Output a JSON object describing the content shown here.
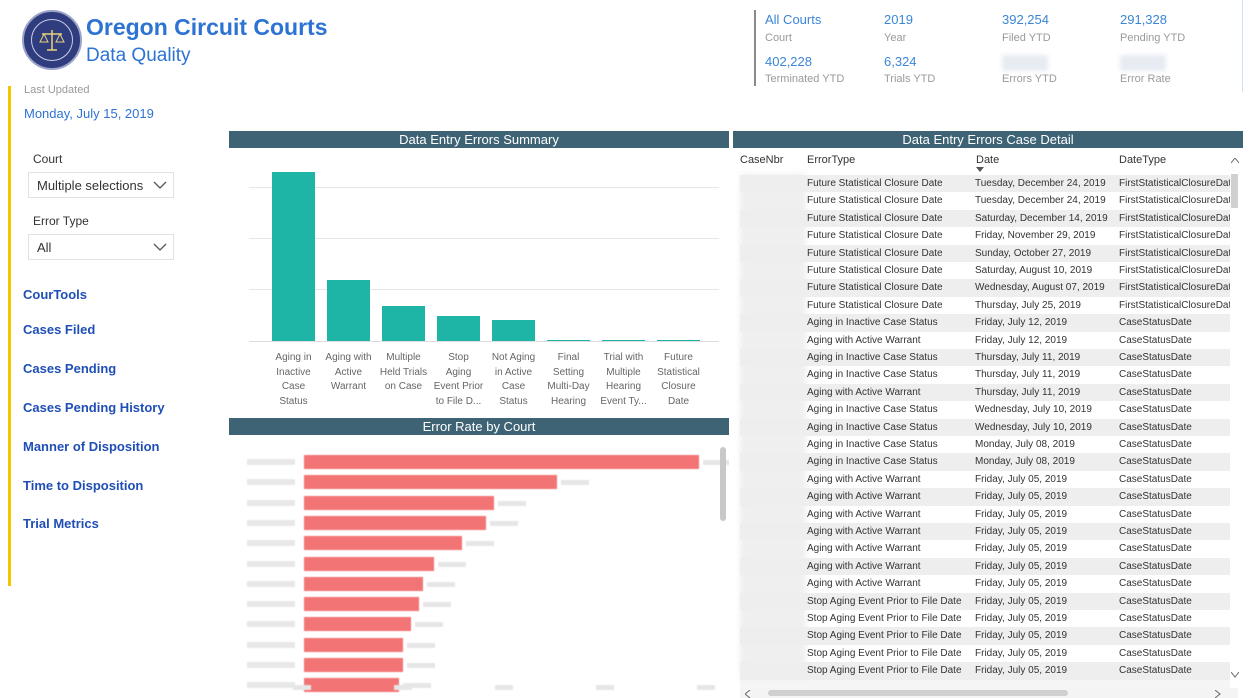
{
  "header": {
    "title": "Oregon Circuit Courts",
    "subtitle": "Data Quality",
    "last_updated_label": "Last Updated",
    "last_updated_date": "Monday, July 15, 2019",
    "seal_icon": "oregon-judicial-department-seal"
  },
  "kpis": [
    {
      "value": "All Courts",
      "label": "Court"
    },
    {
      "value": "2019",
      "label": "Year"
    },
    {
      "value": "392,254",
      "label": "Filed YTD"
    },
    {
      "value": "291,328",
      "label": "Pending YTD"
    },
    {
      "value": "402,228",
      "label": "Terminated YTD"
    },
    {
      "value": "6,324",
      "label": "Trials YTD"
    },
    {
      "value": "",
      "label": "Errors YTD"
    },
    {
      "value": "",
      "label": "Error Rate"
    }
  ],
  "filters": {
    "court": {
      "label": "Court",
      "value": "Multiple selections"
    },
    "error_type": {
      "label": "Error Type",
      "value": "All"
    }
  },
  "nav": [
    "CourTools",
    "Cases Filed",
    "Cases Pending",
    "Cases Pending History",
    "Manner of Disposition",
    "Time to Disposition",
    "Trial Metrics"
  ],
  "summary_chart": {
    "title": "Data Entry Errors Summary",
    "chart_data": {
      "type": "bar",
      "categories": [
        "Aging in Inactive Case Status",
        "Aging with Active Warrant",
        "Multiple Held Trials on Case",
        "Stop Aging Event Prior to File D...",
        "Not Aging in Active Case Status",
        "Final Setting Multi-Day Hearing",
        "Trial with Multiple Hearing Event Ty...",
        "Future Statistical Closure Date"
      ],
      "category_lines": [
        [
          "Aging in",
          "Inactive",
          "Case",
          "Status"
        ],
        [
          "Aging with",
          "Active",
          "Warrant"
        ],
        [
          "Multiple",
          "Held Trials",
          "on Case"
        ],
        [
          "Stop",
          "Aging",
          "Event Prior",
          "to File D..."
        ],
        [
          "Not Aging",
          "in Active",
          "Case",
          "Status"
        ],
        [
          "Final",
          "Setting",
          "Multi-Day",
          "Hearing"
        ],
        [
          "Trial with",
          "Multiple",
          "Hearing",
          "Event Ty..."
        ],
        [
          "Future",
          "Statistical",
          "Closure",
          "Date"
        ]
      ],
      "values": [
        100,
        36,
        21,
        15,
        12.5,
        0.6,
        0.6,
        0.6
      ],
      "ylim": [
        0,
        100
      ],
      "grid": true,
      "color": "#1fb5a6"
    }
  },
  "rate_chart": {
    "title": "Error Rate by Court",
    "chart_data": {
      "type": "bar",
      "orientation": "horizontal",
      "note_blurred": true,
      "values": [
        1.0,
        0.64,
        0.48,
        0.46,
        0.4,
        0.33,
        0.3,
        0.29,
        0.27,
        0.25,
        0.25,
        0.24
      ],
      "color": "#f27474"
    }
  },
  "detail_table": {
    "title": "Data Entry Errors Case Detail",
    "columns": [
      "CaseNbr",
      "ErrorType",
      "Date",
      "DateType"
    ],
    "rows": [
      [
        "Future Statistical Closure Date",
        "Tuesday, December 24, 2019",
        "FirstStatisticalClosureDat"
      ],
      [
        "Future Statistical Closure Date",
        "Tuesday, December 24, 2019",
        "FirstStatisticalClosureDat"
      ],
      [
        "Future Statistical Closure Date",
        "Saturday, December 14, 2019",
        "FirstStatisticalClosureDat"
      ],
      [
        "Future Statistical Closure Date",
        "Friday, November 29, 2019",
        "FirstStatisticalClosureDat"
      ],
      [
        "Future Statistical Closure Date",
        "Sunday, October 27, 2019",
        "FirstStatisticalClosureDat"
      ],
      [
        "Future Statistical Closure Date",
        "Saturday, August 10, 2019",
        "FirstStatisticalClosureDat"
      ],
      [
        "Future Statistical Closure Date",
        "Wednesday, August 07, 2019",
        "FirstStatisticalClosureDat"
      ],
      [
        "Future Statistical Closure Date",
        "Thursday, July 25, 2019",
        "FirstStatisticalClosureDat"
      ],
      [
        "Aging in Inactive Case Status",
        "Friday, July 12, 2019",
        "CaseStatusDate"
      ],
      [
        "Aging with Active Warrant",
        "Friday, July 12, 2019",
        "CaseStatusDate"
      ],
      [
        "Aging in Inactive Case Status",
        "Thursday, July 11, 2019",
        "CaseStatusDate"
      ],
      [
        "Aging in Inactive Case Status",
        "Thursday, July 11, 2019",
        "CaseStatusDate"
      ],
      [
        "Aging with Active Warrant",
        "Thursday, July 11, 2019",
        "CaseStatusDate"
      ],
      [
        "Aging in Inactive Case Status",
        "Wednesday, July 10, 2019",
        "CaseStatusDate"
      ],
      [
        "Aging in Inactive Case Status",
        "Wednesday, July 10, 2019",
        "CaseStatusDate"
      ],
      [
        "Aging in Inactive Case Status",
        "Monday, July 08, 2019",
        "CaseStatusDate"
      ],
      [
        "Aging in Inactive Case Status",
        "Monday, July 08, 2019",
        "CaseStatusDate"
      ],
      [
        "Aging with Active Warrant",
        "Friday, July 05, 2019",
        "CaseStatusDate"
      ],
      [
        "Aging with Active Warrant",
        "Friday, July 05, 2019",
        "CaseStatusDate"
      ],
      [
        "Aging with Active Warrant",
        "Friday, July 05, 2019",
        "CaseStatusDate"
      ],
      [
        "Aging with Active Warrant",
        "Friday, July 05, 2019",
        "CaseStatusDate"
      ],
      [
        "Aging with Active Warrant",
        "Friday, July 05, 2019",
        "CaseStatusDate"
      ],
      [
        "Aging with Active Warrant",
        "Friday, July 05, 2019",
        "CaseStatusDate"
      ],
      [
        "Aging with Active Warrant",
        "Friday, July 05, 2019",
        "CaseStatusDate"
      ],
      [
        "Stop Aging Event Prior to File Date",
        "Friday, July 05, 2019",
        "CaseStatusDate"
      ],
      [
        "Stop Aging Event Prior to File Date",
        "Friday, July 05, 2019",
        "CaseStatusDate"
      ],
      [
        "Stop Aging Event Prior to File Date",
        "Friday, July 05, 2019",
        "CaseStatusDate"
      ],
      [
        "Stop Aging Event Prior to File Date",
        "Friday, July 05, 2019",
        "CaseStatusDate"
      ],
      [
        "Stop Aging Event Prior to File Date",
        "Friday, July 05, 2019",
        "CaseStatusDate"
      ]
    ],
    "sort_icon": "sort-descending-icon"
  }
}
